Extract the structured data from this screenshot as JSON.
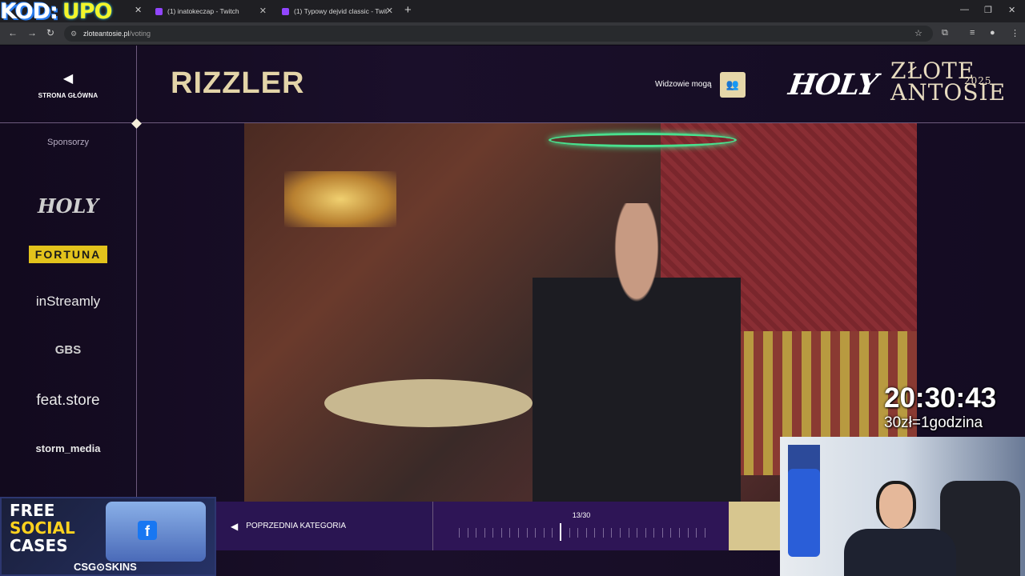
{
  "stream_overlay": {
    "banner_left": "KOD:",
    "banner_right": "UPO",
    "clock": "20:30:43",
    "rate": "30zł=1godzina"
  },
  "browser": {
    "tabs": [
      {
        "label": "(1) inatokeczap - Twitch",
        "active": false
      },
      {
        "label": "(1) Typowy dejvid classic - Twit",
        "active": false
      }
    ],
    "url_host": "zloteantosie.pl",
    "url_path": "/voting"
  },
  "site": {
    "home_label": "STRONA GŁÓWNA",
    "category_title": "RIZZLER",
    "viewers_label": "Widzowie mogą",
    "logo_holy": "HOLY",
    "logo_line1": "ZŁOTE",
    "logo_line2": "ANTOSIE",
    "logo_year": "2025",
    "sponsors_heading": "Sponsorzy",
    "sponsors": [
      "HOLY",
      "FORTUNA",
      "inStreamly",
      "GBS",
      "feat.store",
      "storm_media"
    ],
    "prev_category": "POPRZEDNIA KATEGORIA",
    "progress_text": "13/30",
    "progress": {
      "current": 13,
      "total": 30
    }
  },
  "ad": {
    "line1": "FREE",
    "line2": "SOCIAL",
    "line3": "CASES",
    "brand": "CSG⊙SKINS"
  }
}
